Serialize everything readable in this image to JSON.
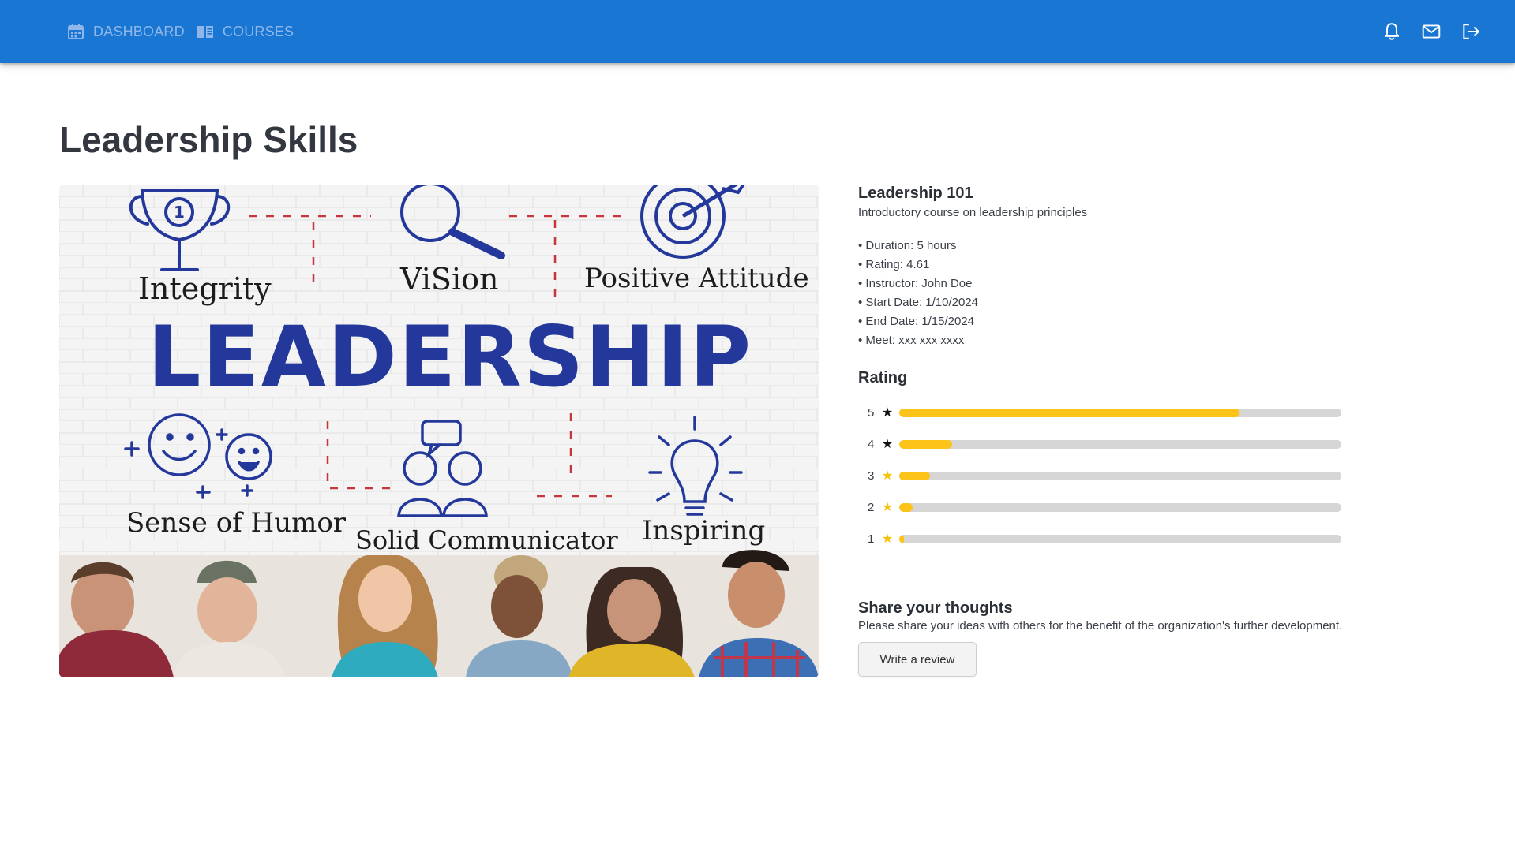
{
  "nav": {
    "dashboard_label": "DASHBOARD",
    "courses_label": "COURSES"
  },
  "header": {
    "icons": [
      "bell-icon",
      "mail-icon",
      "logout-icon"
    ],
    "bar_color": "#1976d2"
  },
  "page": {
    "title": "Leadership Skills"
  },
  "hero_image": {
    "texts": {
      "word_integrity": "Integrity",
      "word_vision": "ViSion",
      "word_attitude": "Positive Attitude",
      "word_main": "LEADERSHIP",
      "word_humor": "Sense of Humor",
      "word_communicator": "Solid Communicator",
      "word_inspiring": "Inspiring"
    }
  },
  "course": {
    "title": "Leadership 101",
    "description": "Introductory course on leadership principles",
    "details": [
      "• Duration: 5 hours",
      "• Rating: 4.61",
      "• Instructor: John Doe",
      "• Start Date: 1/10/2024",
      "• End Date: 1/15/2024",
      "• Meet: xxx xxx xxxx"
    ]
  },
  "rating": {
    "title": "Rating",
    "rows": [
      {
        "stars": "5",
        "fraction": 0.77,
        "star_style": "black"
      },
      {
        "stars": "4",
        "fraction": 0.12,
        "star_style": "black"
      },
      {
        "stars": "3",
        "fraction": 0.07,
        "star_style": "gold"
      },
      {
        "stars": "2",
        "fraction": 0.03,
        "star_style": "gold"
      },
      {
        "stars": "1",
        "fraction": 0.01,
        "star_style": "gold"
      }
    ],
    "fill_color": "#fcc419",
    "track_color": "#d6d6d6"
  },
  "share": {
    "title": "Share your thoughts",
    "description": "Please share your ideas with others for the benefit of the organization's further development.",
    "button_label": "Write a review"
  }
}
